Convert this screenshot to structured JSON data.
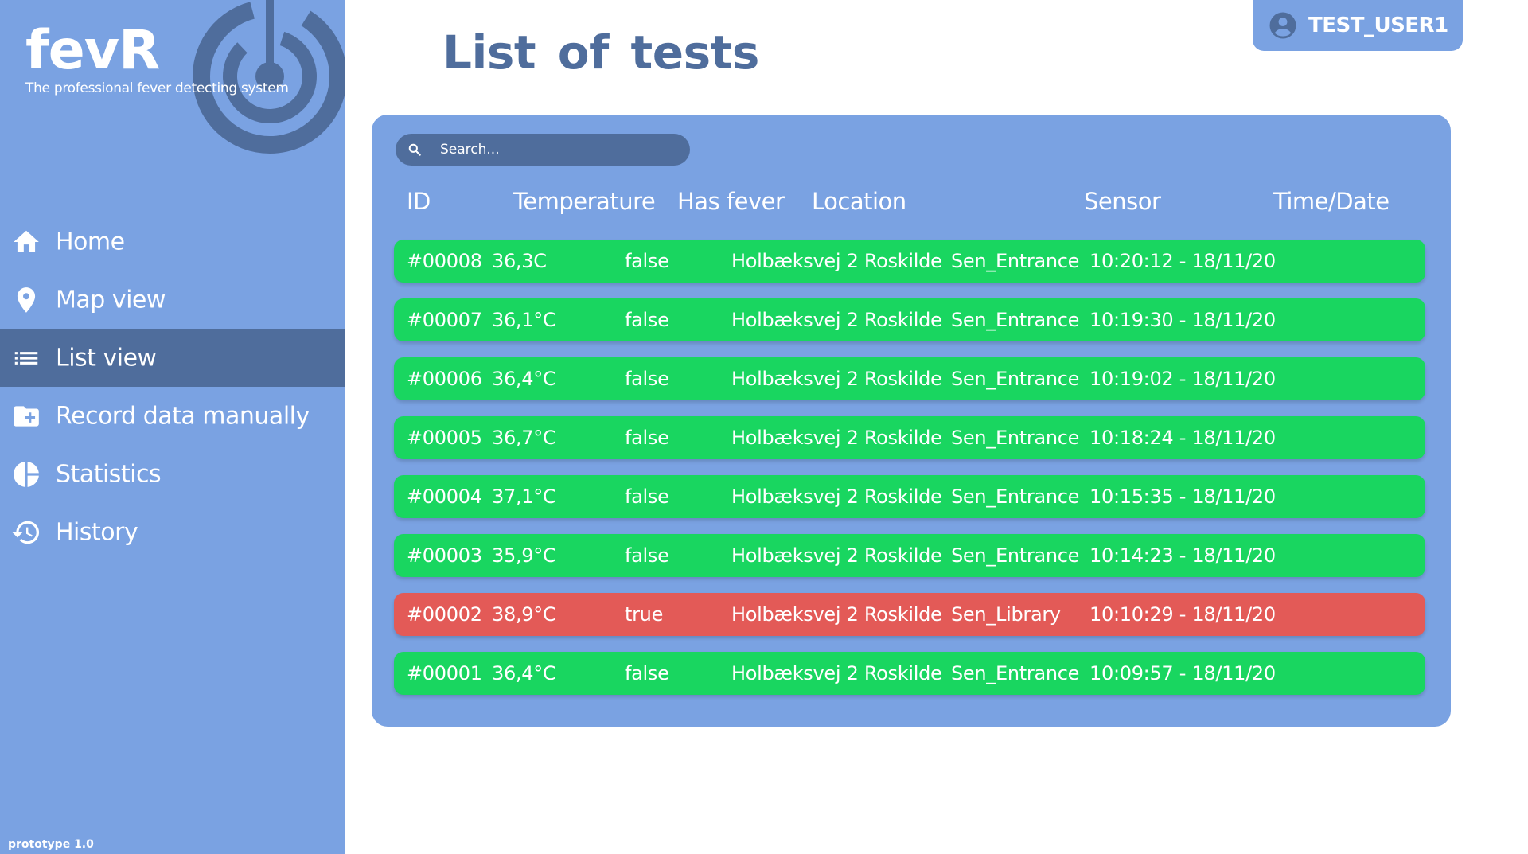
{
  "colors": {
    "sidebar": "#7aa2e2",
    "sidebar_active": "#4f6d9c",
    "title": "#4f6d9c",
    "row_ok": "#19d660",
    "row_fever": "#e35a57"
  },
  "brand": {
    "name": "fevR",
    "tagline": "The professional fever detecting system",
    "logo_icon": "target-signal-icon"
  },
  "nav": {
    "items": [
      {
        "label": "Home",
        "icon": "home-icon",
        "active": false
      },
      {
        "label": "Map view",
        "icon": "map-pin-icon",
        "active": false
      },
      {
        "label": "List view",
        "icon": "list-icon",
        "active": true
      },
      {
        "label": "Record data manually",
        "icon": "folder-plus-icon",
        "active": false
      },
      {
        "label": "Statistics",
        "icon": "pie-chart-icon",
        "active": false
      },
      {
        "label": "History",
        "icon": "history-icon",
        "active": false
      }
    ]
  },
  "version": "prototype 1.0",
  "page_title": "List of tests",
  "user": {
    "name": "TEST_USER1",
    "icon": "account-circle-icon"
  },
  "search": {
    "placeholder": "Search...",
    "icon": "search-icon"
  },
  "table": {
    "columns": [
      "ID",
      "Temperature",
      "Has fever",
      "Location",
      "Sensor",
      "Time/Date"
    ],
    "rows": [
      {
        "id": "#00008",
        "temperature": "36,3C",
        "has_fever": "false",
        "location": "Holbæksvej 2 Roskilde",
        "sensor": "Sen_Entrance",
        "time": "10:20:12 - 18/11/20"
      },
      {
        "id": "#00007",
        "temperature": "36,1°C",
        "has_fever": "false",
        "location": "Holbæksvej 2 Roskilde",
        "sensor": "Sen_Entrance",
        "time": "10:19:30 - 18/11/20"
      },
      {
        "id": "#00006",
        "temperature": "36,4°C",
        "has_fever": "false",
        "location": "Holbæksvej 2 Roskilde",
        "sensor": "Sen_Entrance",
        "time": "10:19:02 - 18/11/20"
      },
      {
        "id": "#00005",
        "temperature": "36,7°C",
        "has_fever": "false",
        "location": "Holbæksvej 2 Roskilde",
        "sensor": "Sen_Entrance",
        "time": "10:18:24 - 18/11/20"
      },
      {
        "id": "#00004",
        "temperature": "37,1°C",
        "has_fever": "false",
        "location": "Holbæksvej 2 Roskilde",
        "sensor": "Sen_Entrance",
        "time": "10:15:35 - 18/11/20"
      },
      {
        "id": "#00003",
        "temperature": "35,9°C",
        "has_fever": "false",
        "location": "Holbæksvej 2 Roskilde",
        "sensor": "Sen_Entrance",
        "time": "10:14:23 - 18/11/20"
      },
      {
        "id": "#00002",
        "temperature": "38,9°C",
        "has_fever": "true",
        "location": "Holbæksvej 2 Roskilde",
        "sensor": "Sen_Library",
        "time": "10:10:29 - 18/11/20"
      },
      {
        "id": "#00001",
        "temperature": "36,4°C",
        "has_fever": "false",
        "location": "Holbæksvej 2 Roskilde",
        "sensor": "Sen_Entrance",
        "time": "10:09:57 - 18/11/20"
      }
    ]
  }
}
